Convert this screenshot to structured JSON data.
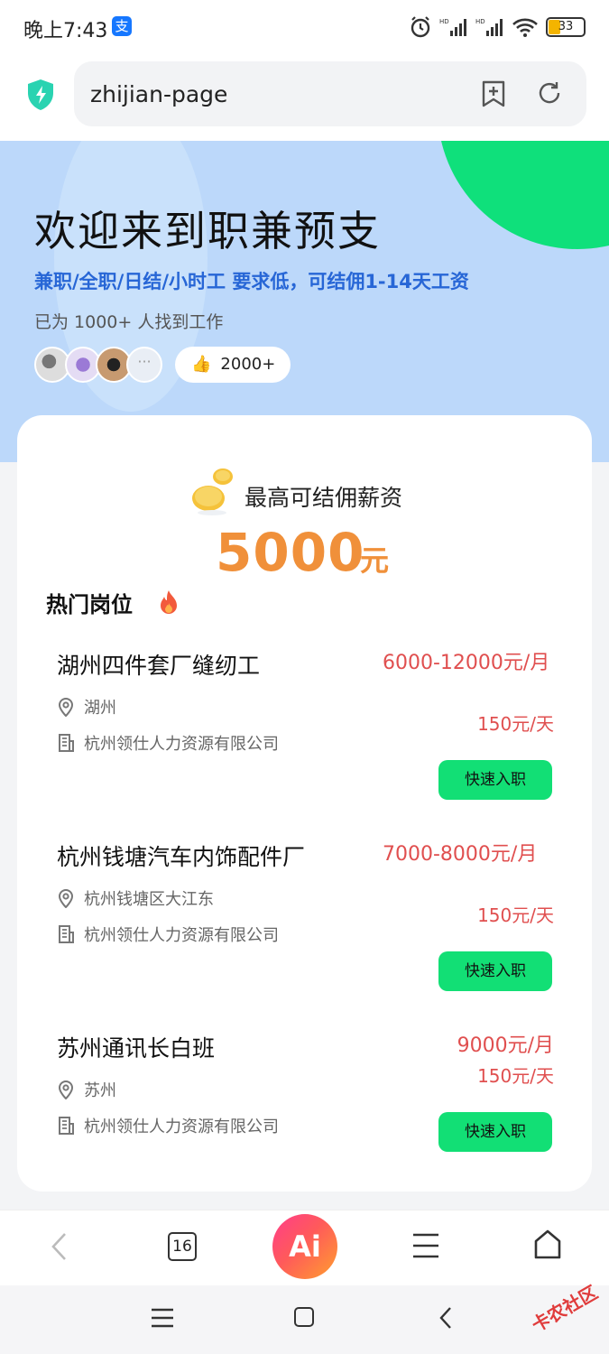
{
  "status_bar": {
    "time": "晚上7:43",
    "app_icon_char": "支",
    "battery": "33"
  },
  "browser": {
    "url": "zhijian-page",
    "tab_count": "16",
    "ai_label": "Ai"
  },
  "hero": {
    "title": "欢迎来到职兼预支",
    "subtitle": "兼职/全职/日结/小时工 要求低，可结佣1-14天工资",
    "found_text": "已为 1000+ 人找到工作",
    "likes": "2000+"
  },
  "card": {
    "max_label": "最高可结佣薪资",
    "max_amount": "5000",
    "max_unit": "元",
    "hot_title": "热门岗位"
  },
  "jobs": [
    {
      "title": "湖州四件套厂缝纫工",
      "salary": "6000-12000元/月",
      "daily": "150元/天",
      "location": "湖州",
      "company": "杭州领仕人力资源有限公司",
      "button": "快速入职"
    },
    {
      "title": "杭州钱塘汽车内饰配件厂",
      "salary": "7000-8000元/月",
      "daily": "150元/天",
      "location": "杭州钱塘区大江东",
      "company": "杭州领仕人力资源有限公司",
      "button": "快速入职"
    },
    {
      "title": "苏州通讯长白班",
      "salary": "9000元/月",
      "daily": "150元/天",
      "location": "苏州",
      "company": "杭州领仕人力资源有限公司",
      "button": "快速入职"
    }
  ],
  "watermark": "卡农社区",
  "colors": {
    "accent_green": "#12df75",
    "salary_red": "#e04f4f",
    "amount_orange": "#f0903a",
    "hero_blue": "#bcd8fa",
    "subtitle_blue": "#2766d6"
  }
}
